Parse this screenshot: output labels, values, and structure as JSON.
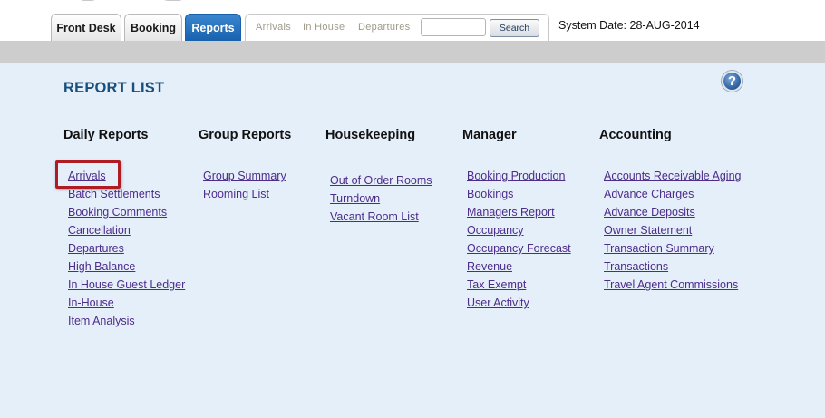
{
  "tabs": [
    {
      "label": "Front Desk",
      "active": false
    },
    {
      "label": "Booking",
      "active": false
    },
    {
      "label": "Reports",
      "active": true
    }
  ],
  "quick_links": [
    "Arrivals",
    "In House",
    "Departures"
  ],
  "search": {
    "placeholder": "",
    "value": "",
    "button_label": "Search"
  },
  "system_date": "System Date: 28-AUG-2014",
  "page_title": "REPORT LIST",
  "help_icon": "question-circle-icon",
  "selected_report": "Arrivals",
  "colors": {
    "accent": "#1862ad",
    "title": "#184f7c",
    "link": "#4d2c8a",
    "highlight": "#b01c23",
    "background": "#e5effa"
  },
  "columns": [
    {
      "heading": "Daily Reports",
      "reports": [
        "Arrivals",
        "Batch Settlements",
        "Booking Comments",
        "Cancellation",
        "Departures",
        "High Balance",
        "In House Guest Ledger",
        "In-House",
        "Item Analysis"
      ]
    },
    {
      "heading": "Group Reports",
      "reports": [
        "Group Summary",
        "Rooming List"
      ]
    },
    {
      "heading": "Housekeeping",
      "reports": [
        "Out of Order Rooms",
        "Turndown",
        "Vacant Room List"
      ]
    },
    {
      "heading": "Manager",
      "reports": [
        "Booking Production",
        "Bookings",
        "Managers Report",
        "Occupancy",
        "Occupancy Forecast",
        "Revenue",
        "Tax Exempt",
        "User Activity"
      ]
    },
    {
      "heading": "Accounting",
      "reports": [
        "Accounts Receivable Aging",
        "Advance Charges",
        "Advance Deposits",
        "Owner Statement",
        "Transaction Summary",
        "Transactions",
        "Travel Agent Commissions"
      ]
    }
  ]
}
